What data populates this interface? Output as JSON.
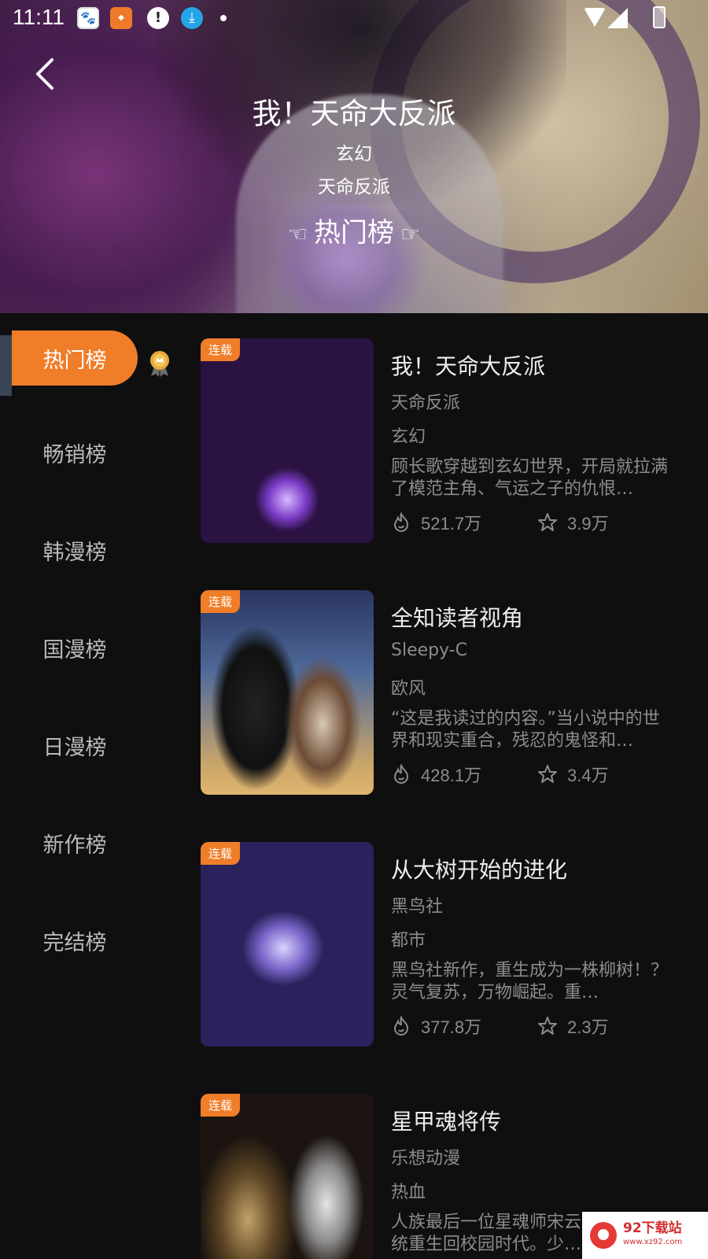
{
  "status_bar": {
    "time": "11:11",
    "icons": [
      "baidu-icon",
      "app-icon",
      "alert-icon",
      "download-icon",
      "wifi-icon",
      "signal-icon",
      "battery-icon"
    ]
  },
  "header": {
    "title": "我！天命大反派",
    "genre": "玄幻",
    "author": "天命反派",
    "rank_label": "热门榜",
    "hand_left": "☜",
    "hand_right": "☞"
  },
  "sidebar": {
    "items": [
      {
        "label": "热门榜",
        "active": true
      },
      {
        "label": "畅销榜",
        "active": false
      },
      {
        "label": "韩漫榜",
        "active": false
      },
      {
        "label": "国漫榜",
        "active": false
      },
      {
        "label": "日漫榜",
        "active": false
      },
      {
        "label": "新作榜",
        "active": false
      },
      {
        "label": "完结榜",
        "active": false
      }
    ]
  },
  "list": [
    {
      "tag": "连载",
      "title": "我！天命大反派",
      "author": "天命反派",
      "genre": "玄幻",
      "desc": "顾长歌穿越到玄幻世界，开局就拉满了模范主角、气运之子的仇恨…",
      "views": "521.7万",
      "favs": "3.9万"
    },
    {
      "tag": "连载",
      "title": "全知读者视角",
      "author": "Sleepy-C",
      "genre": "欧风",
      "desc": "“这是我读过的内容。”当小说中的世界和现实重合，残忍的鬼怪和…",
      "views": "428.1万",
      "favs": "3.4万"
    },
    {
      "tag": "连载",
      "title": "从大树开始的进化",
      "author": "黑鸟社",
      "genre": "都市",
      "desc": "黑鸟社新作，重生成为一株柳树！？灵气复苏，万物崛起。重…",
      "views": "377.8万",
      "favs": "2.3万"
    },
    {
      "tag": "连载",
      "title": "星甲魂将传",
      "author": "乐想动漫",
      "genre": "热血",
      "desc": "人族最后一位星魂师宋云逍，带着系统重生回校园时代。少…",
      "views": "",
      "favs": ""
    }
  ],
  "watermark": {
    "name": "92下载站",
    "url": "www.xz92.com"
  },
  "colors": {
    "accent": "#f07d28",
    "background": "#0f0f10",
    "text_muted": "#8c8c8c"
  }
}
